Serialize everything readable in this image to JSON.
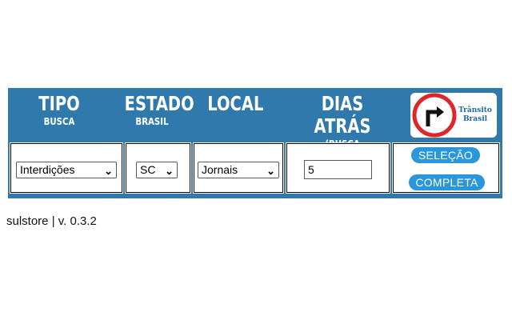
{
  "headers": {
    "tipo": {
      "main": "TIPO",
      "sub": "BUSCA"
    },
    "estado": {
      "main": "ESTADO",
      "sub": "BRASIL"
    },
    "local": {
      "main": "LOCAL",
      "sub": ""
    },
    "dias": {
      "main": "DIAS ATRÁS",
      "sub": "(BUSCA RETROATIVA)"
    }
  },
  "logo": {
    "line1": "Trânsito",
    "line2": "Brasil",
    "icon": "turn-right-sign-icon"
  },
  "controls": {
    "tipo_value": "Interdições",
    "estado_value": "SC",
    "local_value": "Jornais",
    "dias_value": "5",
    "chevron": "⌄"
  },
  "buttons": {
    "selecao": "SELEÇÃO",
    "completa": "COMPLETA"
  },
  "footer": {
    "brand": "sulstore",
    "separator": "|",
    "version": "v. 0.3.2"
  },
  "colors": {
    "panel": "#2f79ad",
    "button": "#2a97dd",
    "logo_text": "#1c6aa0",
    "sign_red": "#e0252b"
  }
}
